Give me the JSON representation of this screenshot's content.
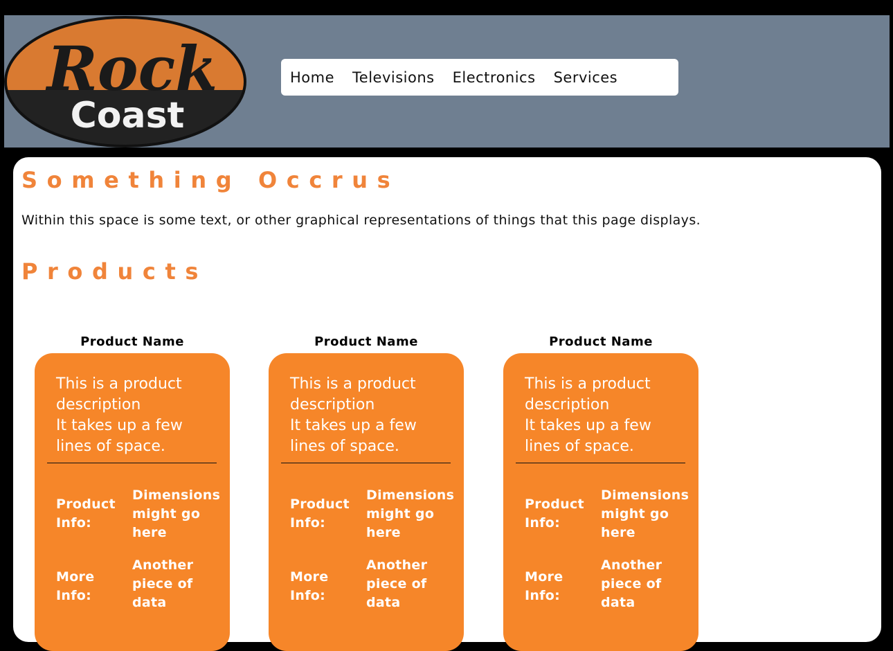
{
  "logo": {
    "line1": "Rock",
    "line2": "Coast",
    "colors": {
      "top": "#d97a31",
      "bottom": "#222222",
      "outline": "#111111"
    }
  },
  "nav": {
    "items": [
      {
        "label": "Home"
      },
      {
        "label": "Televisions"
      },
      {
        "label": "Electronics"
      },
      {
        "label": "Services"
      }
    ]
  },
  "main": {
    "title": "Something Occrus",
    "intro": "Within this space is some text, or other graphical representations of things that this page displays.",
    "products_heading": "Products"
  },
  "products": [
    {
      "name": "Product Name",
      "description_line1": "This is a product description",
      "description_line2": "It takes up a few lines of space.",
      "info_label": "Product Info:",
      "info_value": "Dimensions might go here",
      "more_label": "More Info:",
      "more_value": "Another piece of data"
    },
    {
      "name": "Product Name",
      "description_line1": "This is a product description",
      "description_line2": "It takes up a few lines of space.",
      "info_label": "Product Info:",
      "info_value": "Dimensions might go here",
      "more_label": "More Info:",
      "more_value": "Another piece of data"
    },
    {
      "name": "Product Name",
      "description_line1": "This is a product description",
      "description_line2": "It takes up a few lines of space.",
      "info_label": "Product Info:",
      "info_value": "Dimensions might go here",
      "more_label": "More Info:",
      "more_value": "Another piece of data"
    }
  ],
  "colors": {
    "header_bg": "#6f7f91",
    "heading": "#f0843a",
    "card_bg": "#f68629"
  }
}
